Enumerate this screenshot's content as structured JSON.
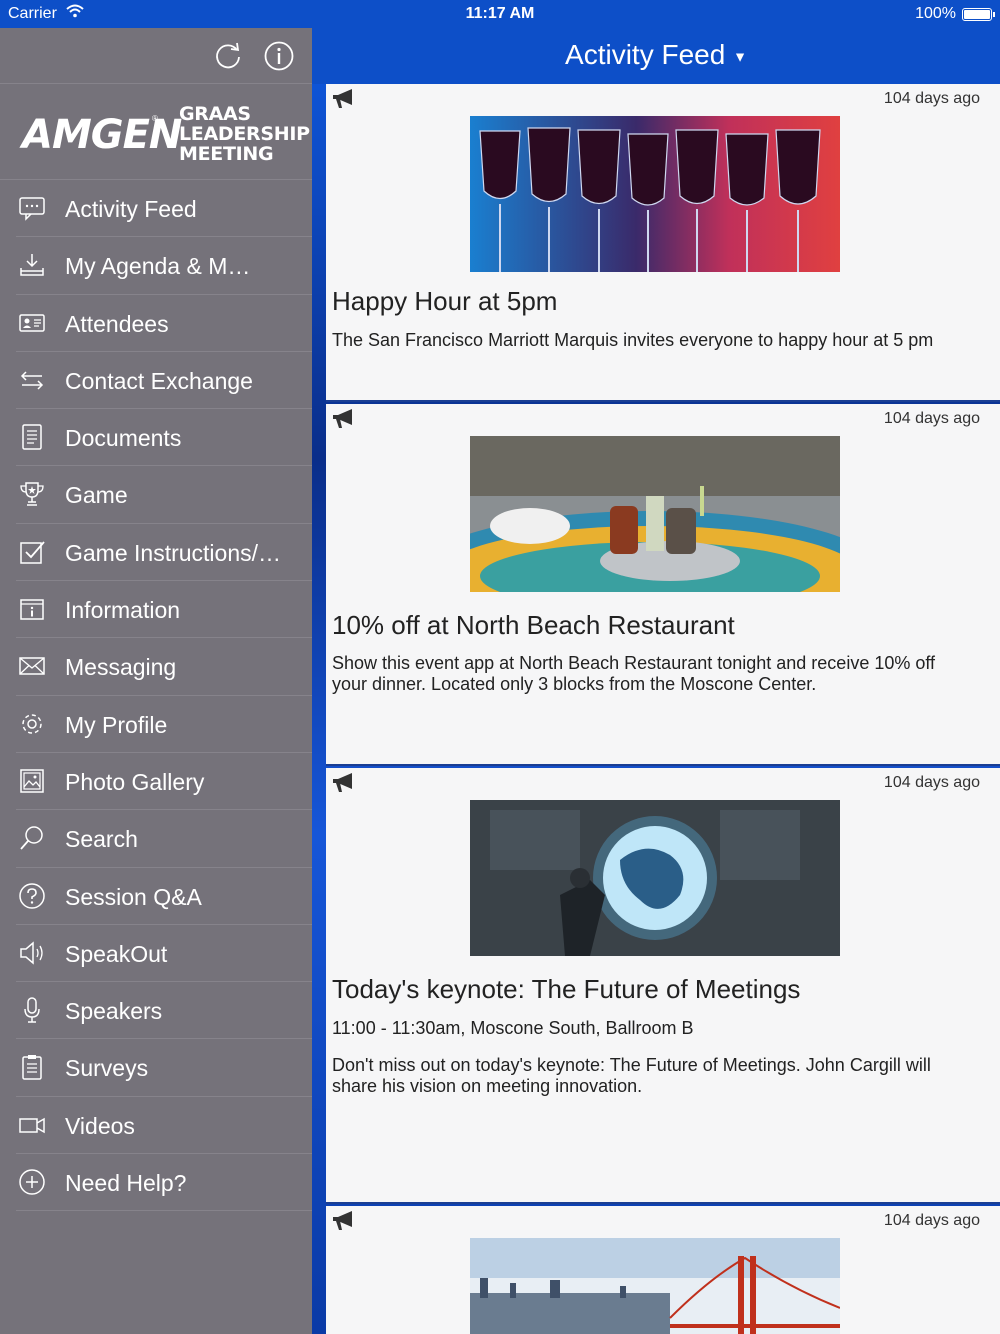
{
  "status_bar": {
    "carrier": "Carrier",
    "time": "11:17 AM",
    "battery": "100%"
  },
  "sidebar": {
    "logo": {
      "brand": "AMGEN",
      "event_line1": "GRAAS",
      "event_line2": "LEADERSHIP",
      "event_line3": "MEETING"
    },
    "items": [
      {
        "label": "Activity Feed",
        "icon": "speech-bubble-icon"
      },
      {
        "label": "My Agenda & M…",
        "icon": "inbox-download-icon"
      },
      {
        "label": "Attendees",
        "icon": "id-card-icon"
      },
      {
        "label": "Contact Exchange",
        "icon": "swap-arrows-icon"
      },
      {
        "label": "Documents",
        "icon": "document-icon"
      },
      {
        "label": "Game",
        "icon": "trophy-icon"
      },
      {
        "label": "Game Instructions/…",
        "icon": "checkbox-icon"
      },
      {
        "label": "Information",
        "icon": "info-box-icon"
      },
      {
        "label": "Messaging",
        "icon": "envelope-icon"
      },
      {
        "label": "My Profile",
        "icon": "gear-icon"
      },
      {
        "label": "Photo Gallery",
        "icon": "picture-icon"
      },
      {
        "label": "Search",
        "icon": "search-icon"
      },
      {
        "label": "Session Q&A",
        "icon": "question-icon"
      },
      {
        "label": "SpeakOut",
        "icon": "speaker-icon"
      },
      {
        "label": "Speakers",
        "icon": "microphone-icon"
      },
      {
        "label": "Surveys",
        "icon": "clipboard-icon"
      },
      {
        "label": "Videos",
        "icon": "video-camera-icon"
      },
      {
        "label": "Need Help?",
        "icon": "plus-circle-icon"
      }
    ]
  },
  "navbar": {
    "title": "Activity Feed"
  },
  "feed": {
    "posts": [
      {
        "age": "104 days ago",
        "title": "Happy Hour at 5pm",
        "subtitle": "",
        "body": "The San Francisco Marriott Marquis invites everyone to happy hour at 5 pm",
        "image": "wine-glasses-photo"
      },
      {
        "age": "104 days ago",
        "title": "10% off at North Beach Restaurant",
        "subtitle": "",
        "body": "Show this event app at North Beach Restaurant tonight and receive 10% off your dinner. Located only 3 blocks from the Moscone Center.",
        "image": "restaurant-table-photo"
      },
      {
        "age": "104 days ago",
        "title": "Today's keynote: The Future of Meetings",
        "subtitle": "11:00 - 11:30am, Moscone South, Ballroom B",
        "body": "Don't miss out on today's keynote: The Future of Meetings. John Cargill will share his vision on meeting innovation.",
        "image": "globe-technology-photo"
      },
      {
        "age": "104 days ago",
        "title": "",
        "subtitle": "",
        "body": "",
        "image": "golden-gate-bridge-photo"
      }
    ]
  },
  "colors": {
    "brand_blue": "#0d4fc8",
    "sidebar_gray": "#75727a",
    "card_bg": "#f6f6f7"
  }
}
